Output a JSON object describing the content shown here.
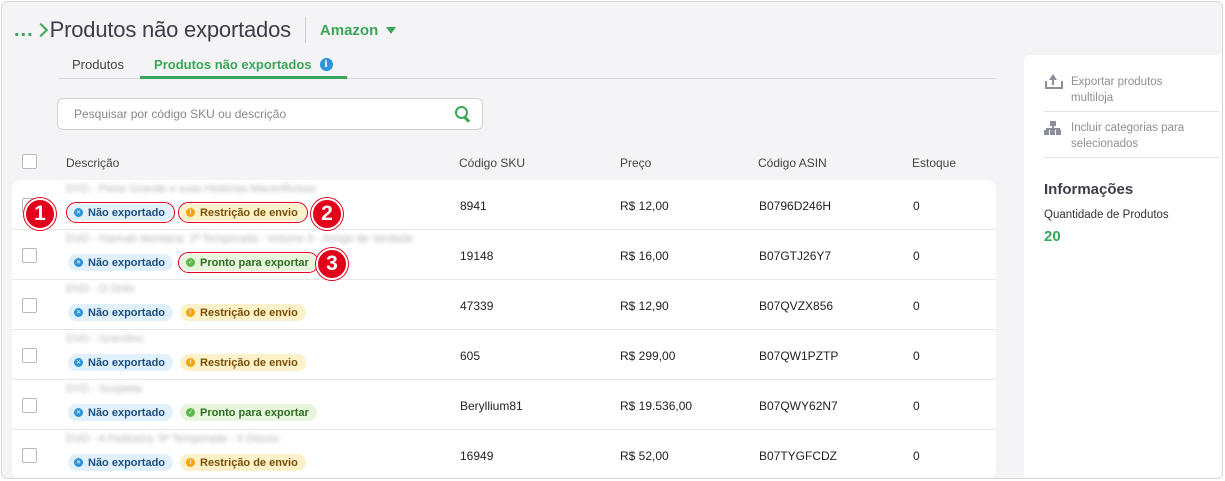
{
  "header": {
    "breadcrumb": "...",
    "title": "Produtos não exportados",
    "store": "Amazon"
  },
  "tabs": [
    {
      "label": "Produtos"
    },
    {
      "label": "Produtos não exportados",
      "info_icon": "i"
    }
  ],
  "search": {
    "placeholder": "Pesquisar por código SKU ou descrição",
    "value": ""
  },
  "table": {
    "columns": [
      "Descrição",
      "Código SKU",
      "Preço",
      "Código ASIN",
      "Estoque"
    ],
    "rows": [
      {
        "description": "DVD - Peixe Grande e suas Histórias Maravilhosas",
        "status": "Não exportado",
        "shipping": "Restrição de envio",
        "shipping_type": "orange",
        "sku": "8941",
        "price": "R$ 12,00",
        "asin": "B0796D246H",
        "stock": "0"
      },
      {
        "description": "DVD - Hannah Montana: 2ª Temporada - Volume 3 - Amigo de Verdade",
        "status": "Não exportado",
        "shipping": "Pronto para exportar",
        "shipping_type": "green",
        "sku": "19148",
        "price": "R$ 16,00",
        "asin": "B07GTJ26Y7",
        "stock": "0"
      },
      {
        "description": "DVD - O Grito",
        "status": "Não exportado",
        "shipping": "Restrição de envio",
        "shipping_type": "orange",
        "sku": "47339",
        "price": "R$ 12,90",
        "asin": "B07QVZX856",
        "stock": "0"
      },
      {
        "description": "DVD - Gremlins",
        "status": "Não exportado",
        "shipping": "Restrição de envio",
        "shipping_type": "orange",
        "sku": "605",
        "price": "R$ 299,00",
        "asin": "B07QW1PZTP",
        "stock": "0"
      },
      {
        "description": "DVD - Suspeita",
        "status": "Não exportado",
        "shipping": "Pronto para exportar",
        "shipping_type": "green",
        "sku": "Beryllium81",
        "price": "R$ 19.536,00",
        "asin": "B07QWY62N7",
        "stock": "0"
      },
      {
        "description": "DVD - A Feiticeira: 8ª Temporada - 4 Discos",
        "status": "Não exportado",
        "shipping": "Restrição de envio",
        "shipping_type": "orange",
        "sku": "16949",
        "price": "R$ 52,00",
        "asin": "B07TYGFCDZ",
        "stock": "0"
      }
    ]
  },
  "markers": [
    "1",
    "2",
    "3"
  ],
  "sidebar": {
    "actions": [
      {
        "label": "Exportar produtos multiloja",
        "icon": "upload-icon"
      },
      {
        "label": "Incluir categorias para selecionados",
        "icon": "sitemap-icon"
      }
    ],
    "info_title": "Informações",
    "product_count_label": "Quantidade de Produtos",
    "product_count": "20"
  },
  "colors": {
    "accent": "#3aa657",
    "info_blue": "#2a95d8",
    "warning": "#f2a414",
    "marker_red": "#e3001b"
  }
}
